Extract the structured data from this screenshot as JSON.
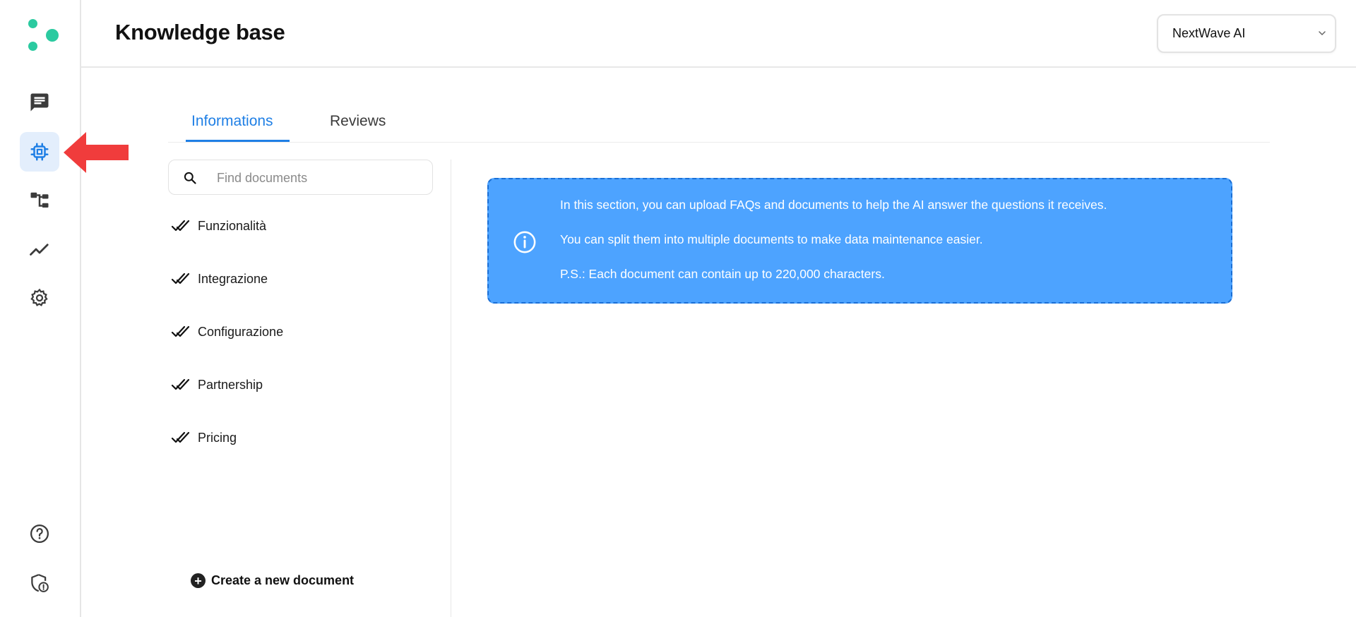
{
  "header": {
    "title": "Knowledge base",
    "workspace": "NextWave AI"
  },
  "sidebar": {
    "items": [
      {
        "icon": "chat-icon",
        "active": false
      },
      {
        "icon": "chip-icon",
        "active": true
      },
      {
        "icon": "workflow-icon",
        "active": false
      },
      {
        "icon": "analytics-icon",
        "active": false
      },
      {
        "icon": "gear-icon",
        "active": false
      },
      {
        "icon": "help-icon",
        "active": false
      },
      {
        "icon": "shield-icon",
        "active": false
      }
    ]
  },
  "tabs": [
    {
      "label": "Informations",
      "active": true
    },
    {
      "label": "Reviews",
      "active": false
    }
  ],
  "search": {
    "placeholder": "Find documents"
  },
  "documents": [
    {
      "label": "Funzionalità",
      "status": "done"
    },
    {
      "label": "Integrazione",
      "status": "done"
    },
    {
      "label": "Configurazione",
      "status": "done"
    },
    {
      "label": "Partnership",
      "status": "done"
    },
    {
      "label": "Pricing",
      "status": "done"
    }
  ],
  "create_document": {
    "label": "Create a new document"
  },
  "info": {
    "lines": [
      "In this section, you can upload FAQs and documents to help the AI answer the questions it receives.",
      "You can split them into multiple documents to make data maintenance easier.",
      "P.S.: Each document can contain up to 220,000 characters."
    ]
  },
  "colors": {
    "accent": "#1f7fe5",
    "info_bg": "#4da3ff",
    "logo": "#2bcaa0",
    "annotation_arrow": "#f03c3c"
  }
}
